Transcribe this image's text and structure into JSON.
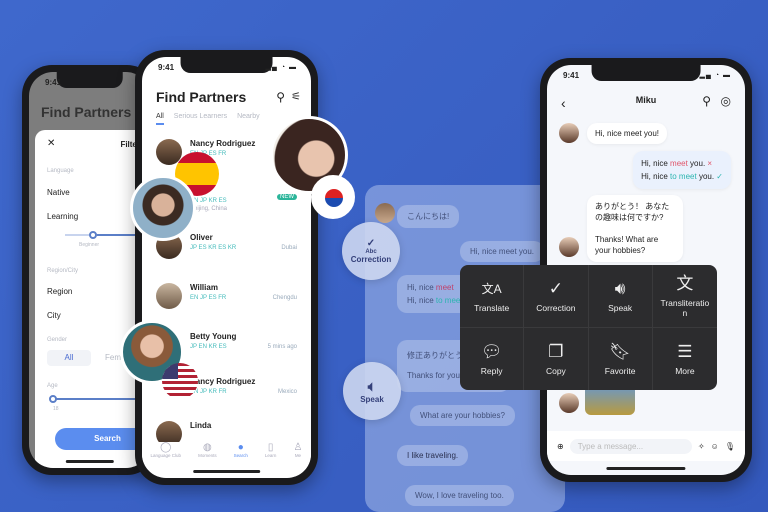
{
  "filter_phone": {
    "time": "9:41",
    "title": "Find Partners",
    "close": "✕",
    "filter_title": "Filter",
    "language_label": "Language",
    "native": "Native",
    "learning": "Learning",
    "level": "Beginner",
    "region_label": "Region/City",
    "region": "Region",
    "city": "City",
    "gender_label": "Gender",
    "gender_all": "All",
    "gender_female": "Female",
    "age_label": "Age",
    "age_min": "18",
    "search": "Search"
  },
  "partners_phone": {
    "time": "9:41",
    "title": "Find Partners",
    "tabs": [
      "All",
      "Serious Learners",
      "Nearby"
    ],
    "rows": [
      {
        "name": "Nancy Rodriguez",
        "langs": "EN  JP     ES  FR"
      },
      {
        "name": "",
        "langs": "EN  JP     KR  ES",
        "meta": "Beijing, China"
      },
      {
        "name": "Oliver",
        "langs": "JP  ES     KR  ES  KR",
        "meta": "Dubai"
      },
      {
        "name": "William",
        "langs": "EN  JP     ES  FR",
        "meta": "Chengdu"
      },
      {
        "name": "Betty Young",
        "langs": "JP  EN     KR  ES",
        "meta": "5 mins ago"
      },
      {
        "name": "Nancy Rodriguez",
        "langs": "EN  JP     KR  FR",
        "meta": "Mexico"
      },
      {
        "name": "Linda",
        "langs": "",
        "meta": ""
      }
    ],
    "new_badge": "NEW",
    "nav": [
      "Language Club",
      "Moments",
      "Search",
      "Learn",
      "Me"
    ]
  },
  "chat_phone": {
    "time": "9:41",
    "contact": "Miku",
    "input_placeholder": "Type a message...",
    "msg1": "Hi, nice meet you!",
    "correction_wrong_pre": "Hi, nice ",
    "correction_wrong_word": "meet",
    "correction_wrong_post": " you.",
    "correction_right_pre": "Hi, nice ",
    "correction_right_word": "to meet",
    "correction_right_post": " you.",
    "msg3_jp": "ありがとう！ あなたの趣味は何ですか?",
    "msg3_en": "Thanks! What are your hobbies?"
  },
  "panel": {
    "m1": "こんにちは!",
    "m2": "Hi, nice meet you.",
    "m3a_pre": "Hi, nice ",
    "m3a_word": "meet",
    "m3b_pre": "Hi, nice ",
    "m3b_word": "to meet",
    "m4": "修正ありがとう",
    "m4b": "Thanks for your correction",
    "m5": "What are your hobbies?",
    "m6": "I like traveling.",
    "m7": "Wow, I love traveling too."
  },
  "feature_bubbles": {
    "correction": "Correction",
    "correction_icon_text": "Abc",
    "speak": "Speak"
  },
  "menu": [
    {
      "icon": "translate-icon",
      "glyph": "文A",
      "label": "Translate"
    },
    {
      "icon": "correction-icon",
      "glyph": "✓",
      "label": "Correction"
    },
    {
      "icon": "speaker-icon",
      "glyph": "🔊︎",
      "label": "Speak"
    },
    {
      "icon": "transliteration-icon",
      "glyph": "文",
      "label": "Transliteration"
    },
    {
      "icon": "reply-icon",
      "glyph": "💬︎",
      "label": "Reply"
    },
    {
      "icon": "copy-icon",
      "glyph": "❐",
      "label": "Copy"
    },
    {
      "icon": "bookmark-icon",
      "glyph": "🔖︎",
      "label": "Favorite"
    },
    {
      "icon": "list-check-icon",
      "glyph": "☰",
      "label": "More"
    }
  ],
  "colors": {
    "background": "#3a62c6",
    "accent": "#5b8def",
    "error": "#e0556a",
    "correct": "#2bb5b0",
    "menu": "#2c2c2e"
  }
}
